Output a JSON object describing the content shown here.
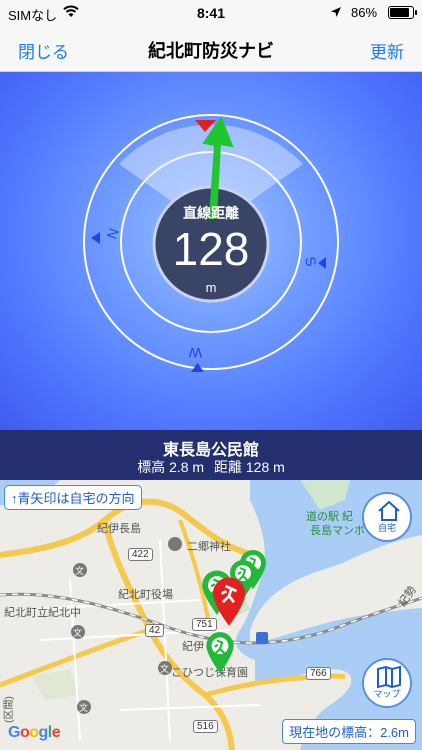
{
  "status_bar": {
    "carrier": "SIMなし",
    "time": "8:41",
    "battery": "86%"
  },
  "nav": {
    "close_label": "閉じる",
    "title": "紀北町防災ナビ",
    "refresh_label": "更新"
  },
  "compass": {
    "center_label": "直線距離",
    "distance_value": "128",
    "distance_unit": "m",
    "directions": {
      "north": "N",
      "south": "S",
      "west": "W"
    }
  },
  "destination": {
    "name": "東長島公民館",
    "elevation_text": "標高 2.8 m",
    "distance_text": "距離 128 m"
  },
  "map": {
    "hint": "↑青矢印は自宅の方向",
    "home_button_label": "自宅",
    "map_button_label": "マップ",
    "current_elevation": "現在地の標高：2.6m",
    "labels": {
      "kii_nagashima": "紀伊長島",
      "nigo_shrine": "二郷神社",
      "kihoku_office": "紀北町役場",
      "kihoku_junior_high": "紀北町立紀北中",
      "kii_station": "紀伊",
      "hitsuji_nursery": "こひつじ保育園",
      "michi_no_eki_1": "道の駅 紀",
      "michi_no_eki_2": "長島マンボ",
      "kisei_line": "紀勢",
      "ward_label": "(区間)",
      "google": "Google"
    },
    "routes": [
      "422",
      "751",
      "42",
      "766",
      "516"
    ]
  }
}
